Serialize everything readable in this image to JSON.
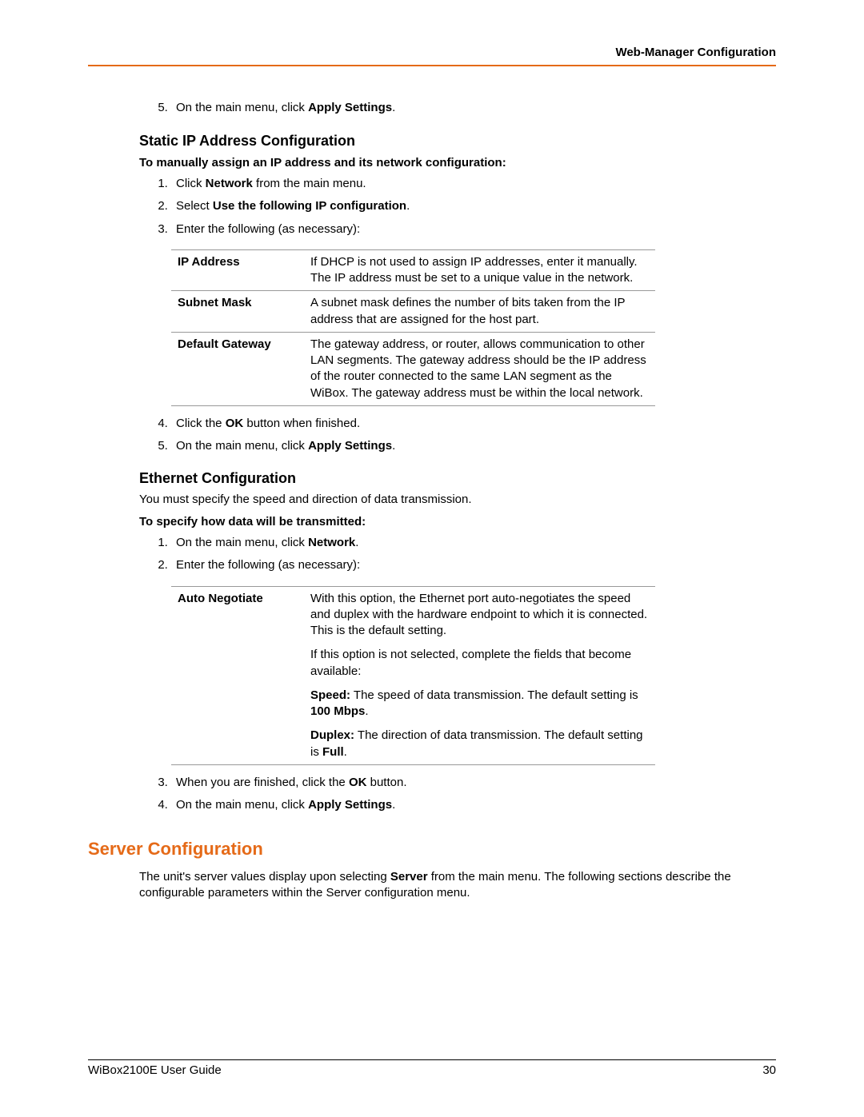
{
  "header": {
    "title": "Web-Manager Configuration"
  },
  "footer": {
    "guide": "WiBox2100E User Guide",
    "page": "30"
  },
  "step5a": {
    "pre": "On the main menu, click ",
    "bold": "Apply Settings",
    "post": "."
  },
  "static_ip": {
    "heading": "Static IP Address Configuration",
    "intro": "To manually assign an IP address and its network configuration:",
    "steps": {
      "s1": {
        "pre": "Click ",
        "bold": "Network",
        "post": " from the main menu."
      },
      "s2": {
        "pre": "Select ",
        "bold": "Use the following IP configuration",
        "post": "."
      },
      "s3": {
        "text": "Enter the following (as necessary):"
      },
      "s4": {
        "pre": "Click the ",
        "bold": "OK",
        "post": " button when finished."
      },
      "s5": {
        "pre": "On the main menu, click ",
        "bold": "Apply Settings",
        "post": "."
      }
    },
    "table": {
      "r1": {
        "k": "IP Address",
        "v": "If DHCP is not used to assign IP addresses, enter it manually. The IP address must be set to a unique value in the network."
      },
      "r2": {
        "k": "Subnet Mask",
        "v": "A subnet mask defines the number of bits taken from the IP address that are assigned for the host part."
      },
      "r3": {
        "k": "Default Gateway",
        "v": "The gateway address, or router, allows communication to other LAN segments. The gateway address should be the IP address of the router connected to the same LAN segment as the WiBox. The gateway address must be within the local network."
      }
    }
  },
  "ethernet": {
    "heading": "Ethernet Configuration",
    "intro": "You must specify the speed and direction of data transmission.",
    "intro2": "To specify how data will be transmitted:",
    "steps": {
      "s1": {
        "pre": "On the main menu, click ",
        "bold": "Network",
        "post": "."
      },
      "s2": {
        "text": "Enter the following (as necessary):"
      },
      "s3": {
        "pre": "When you are finished, click the ",
        "bold": "OK",
        "post": " button."
      },
      "s4": {
        "pre": "On the main menu, click ",
        "bold": "Apply Settings",
        "post": "."
      }
    },
    "table": {
      "k": "Auto Negotiate",
      "p1": "With this option, the Ethernet port auto-negotiates the speed and duplex with the hardware endpoint to which it is connected. This is the default setting.",
      "p2": "If this option is not selected, complete the fields that become available:",
      "p3": {
        "b": "Speed:",
        "t": " The speed of data transmission. The default setting is ",
        "b2": "100 Mbps",
        "t2": "."
      },
      "p4": {
        "b": "Duplex:",
        "t": " The direction of data transmission. The default setting is ",
        "b2": "Full",
        "t2": "."
      }
    }
  },
  "server": {
    "heading": "Server Configuration",
    "para": {
      "pre": "The unit's server values display upon selecting ",
      "bold": "Server",
      "post": " from the main menu. The following sections describe the configurable parameters within the Server configuration menu."
    }
  }
}
